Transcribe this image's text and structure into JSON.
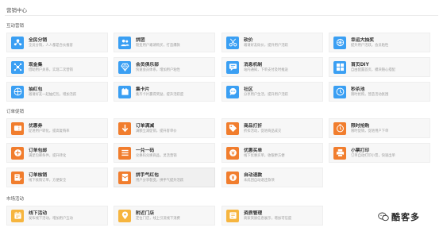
{
  "page": {
    "title": "营销中心"
  },
  "sections": [
    {
      "heading": "互动营销",
      "cards": [
        {
          "title": "全民分销",
          "desc": "全员分销，人人都是合伙推客",
          "icon": "people-network-icon",
          "color": "#3a9ff3"
        },
        {
          "title": "拼团",
          "desc": "裂变用户邀请购买，打造爆款",
          "icon": "group-people-icon",
          "color": "#3a9ff3"
        },
        {
          "title": "砍价",
          "desc": "邀请好友砍价，提升用户活跃",
          "icon": "scissors-icon",
          "color": "#3a9ff3"
        },
        {
          "title": "幸运大抽奖",
          "desc": "提升用户活跃，会员粘性",
          "icon": "lottery-icon",
          "color": "#3a9ff3"
        },
        {
          "title": "现金集",
          "desc": "借助用户关系，实现二次营销",
          "icon": "nodes-icon",
          "color": "#3a9ff3"
        },
        {
          "title": "会员俱乐部",
          "desc": "快速会员体系，增加用户粘性",
          "icon": "diamond-icon",
          "color": "#3a9ff3"
        },
        {
          "title": "消息机制",
          "desc": "站内通知，下单支付及时推送",
          "icon": "message-icon",
          "color": "#3a9ff3"
        },
        {
          "title": "首页DIY",
          "desc": "自由配置首页，模块随心搭配",
          "icon": "layout-icon",
          "color": "#3a9ff3"
        },
        {
          "title": "抽红包",
          "desc": "邀请好友一起抽红包，增加活跃",
          "icon": "redpacket-icon",
          "color": "#3a9ff3"
        },
        {
          "title": "集卡片",
          "desc": "集齐卡片赢得奖励，提升活跃度",
          "icon": "cards-icon",
          "color": "#3a9ff3"
        },
        {
          "title": "社区",
          "desc": "分享用户生活，提升用户活跃",
          "icon": "chat-bubble-icon",
          "color": "#3a9ff3"
        },
        {
          "title": "秒杀池",
          "desc": "限时抢购，营造活动氛围",
          "icon": "clock-icon",
          "color": "#3a9ff3"
        }
      ]
    },
    {
      "heading": "订单促销",
      "cards": [
        {
          "title": "优惠券",
          "desc": "促进用户转化，提高复购率",
          "icon": "coupon-icon",
          "color": "#f17d2d"
        },
        {
          "title": "订单满减",
          "desc": "满额立减促销，提升客单价",
          "icon": "arrow-down-icon",
          "color": "#f17d2d"
        },
        {
          "title": "商品打折",
          "desc": "折扣活动，促进商品成交",
          "icon": "discount-tag-icon",
          "color": "#f17d2d"
        },
        {
          "title": "限时抢购",
          "desc": "限时促销，促进用户下单",
          "icon": "timer-icon",
          "color": "#f17d2d"
        },
        {
          "title": "订单包邮",
          "desc": "满足包邮条件，提升转化",
          "icon": "truck-icon",
          "color": "#f17d2d"
        },
        {
          "title": "一兑一码",
          "desc": "兑换码兑换商品，灵活营销",
          "icon": "code-icon",
          "color": "#f17d2d"
        },
        {
          "title": "优惠买单",
          "desc": "线下优惠买单，收银更方便",
          "icon": "receipt-icon",
          "color": "#f17d2d"
        },
        {
          "title": "小票打印",
          "desc": "订单自动打印小票，快速出单",
          "icon": "printer-icon",
          "color": "#f17d2d"
        },
        {
          "title": "订单核销",
          "desc": "线下核销订单，方便安全",
          "icon": "verify-icon",
          "color": "#f17d2d"
        },
        {
          "title": "拼手气红包",
          "desc": "用户分享裂变，拼手气提升活跃",
          "icon": "lucky-redpacket-icon",
          "color": "#f17d2d"
        },
        {
          "title": "自动退款",
          "desc": "未成团自动退还款项",
          "icon": "refund-icon",
          "color": "#f17d2d"
        }
      ]
    },
    {
      "heading": "市场活动",
      "cards": [
        {
          "title": "线下活动",
          "desc": "发布线下活动，增加用户互动",
          "icon": "calendar-icon",
          "color": "#f6b53f"
        },
        {
          "title": "附近门店",
          "desc": "定位门店，线上引流线下消费",
          "icon": "location-pin-icon",
          "color": "#f6b53f"
        },
        {
          "title": "资质管理",
          "desc": "商家资质信息展示，增加可信度",
          "icon": "certificate-icon",
          "color": "#f6b53f"
        }
      ]
    }
  ],
  "watermark": {
    "text": "酷客多",
    "icon": "wechat-icon"
  }
}
